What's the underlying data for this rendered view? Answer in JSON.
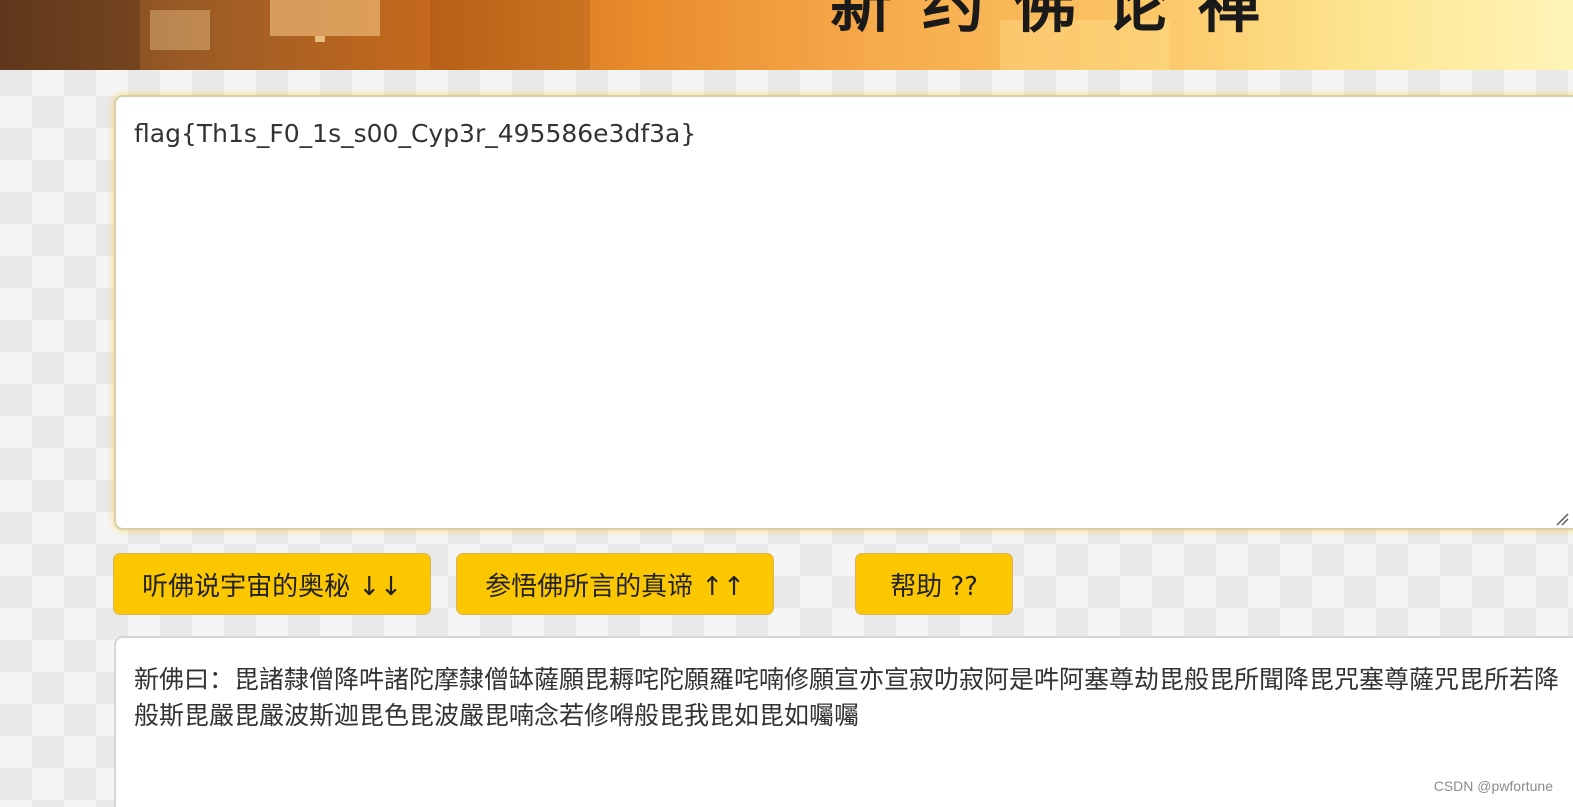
{
  "header": {
    "title": "新约佛论禅"
  },
  "input": {
    "value": "flag{Th1s_F0_1s_s00_Cyp3r_495586e3df3a}"
  },
  "buttons": {
    "encode_label": "听佛说宇宙的奥秘 ↓↓",
    "decode_label": "参悟佛所言的真谛 ↑↑",
    "help_label": "帮助 ??"
  },
  "output": {
    "text": "新佛曰：毘諸隸僧降吽諸陀摩隸僧缽薩願毘耨咤陀願羅咤喃修願宣亦宣寂叻寂阿是吽阿塞尊劫毘般毘所聞降毘咒塞尊薩咒毘所若降般斯毘嚴毘嚴波斯迦毘色毘波嚴毘喃念若修嘚般毘我毘如毘如囑囑"
  },
  "watermark": {
    "text": "CSDN @pwfortune"
  },
  "colors": {
    "button": "#fbc700",
    "glow": "#fac828"
  }
}
